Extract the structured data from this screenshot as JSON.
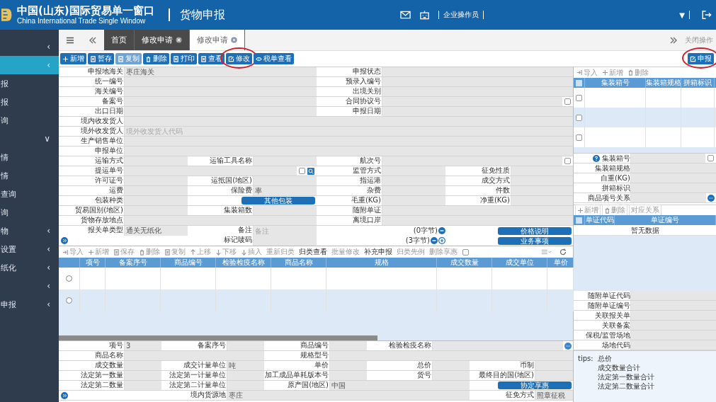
{
  "header": {
    "title": "中国(山东)国际贸易单一窗口",
    "subtitle": "China International Trade Single Window",
    "page": "货物申报",
    "user": "企业操作员",
    "dropdown": "▼"
  },
  "sidebar": {
    "items": [
      {
        "chevron": "‹",
        "selected": false
      },
      {
        "chevron": "‹",
        "selected": true
      },
      {
        "label": "报",
        "selected": false
      },
      {
        "label": "报",
        "selected": false
      },
      {
        "label": "询",
        "selected": false
      },
      {
        "chevron": "∨",
        "selected": false
      },
      {
        "label": "情",
        "selected": false
      },
      {
        "label": "情",
        "selected": false
      },
      {
        "label": "查询",
        "selected": false
      },
      {
        "label": "询",
        "selected": false
      },
      {
        "label": "物",
        "chevron": "‹",
        "selected": false
      },
      {
        "label": "设置",
        "chevron": "‹",
        "selected": false
      },
      {
        "label": "纸化",
        "chevron": "‹",
        "selected": false
      },
      {
        "chevron": "‹",
        "selected": false
      },
      {
        "label": "申报",
        "chevron": "‹",
        "selected": false
      }
    ]
  },
  "tabs": {
    "items": [
      {
        "label": "首页",
        "closable": false,
        "selected": false
      },
      {
        "label": "修改申请",
        "closable": true,
        "selected": false
      },
      {
        "label": "修改申请",
        "closable": true,
        "selected": true
      }
    ],
    "close_menu": "关闭操作"
  },
  "toolbar": {
    "buttons": [
      {
        "label": "新增",
        "disabled": false,
        "highlighted": false
      },
      {
        "label": "暂存",
        "disabled": false,
        "highlighted": false
      },
      {
        "label": "复制",
        "disabled": true,
        "highlighted": false
      },
      {
        "label": "删除",
        "disabled": false,
        "highlighted": false
      },
      {
        "label": "打印",
        "disabled": false,
        "highlighted": false
      },
      {
        "label": "查看",
        "disabled": false,
        "highlighted": false
      },
      {
        "label": "修改",
        "disabled": false,
        "highlighted": true
      },
      {
        "label": "税单查看",
        "disabled": false,
        "highlighted": false
      }
    ],
    "submit": {
      "label": "申报",
      "highlighted": true
    }
  },
  "form": {
    "rows": [
      [
        {
          "kind": "field",
          "label": "申报地海关",
          "value": "枣庄海关"
        },
        "",
        {
          "kind": "field",
          "label": "申报状态"
        },
        ""
      ],
      [
        {
          "kind": "field",
          "label": "统一编号"
        },
        "",
        {
          "kind": "field",
          "label": "预录入编号"
        },
        ""
      ],
      [
        {
          "kind": "field",
          "label": "海关编号"
        },
        "",
        {
          "kind": "field",
          "label": "出境关别"
        },
        ""
      ],
      [
        {
          "kind": "field",
          "label": "备案号"
        },
        "",
        {
          "kind": "field",
          "label": "合同协议号",
          "checked": false
        },
        ""
      ],
      [
        {
          "kind": "field",
          "label": "出口日期"
        },
        "",
        {
          "kind": "field",
          "label": "申报日期"
        },
        ""
      ],
      [
        {
          "kind": "field",
          "label": "境内收发货人"
        },
        "",
        "",
        ""
      ],
      [
        {
          "kind": "field",
          "label": "境外收发货人",
          "placeholder": "境外收发货人代码"
        },
        "",
        "",
        ""
      ],
      [
        {
          "kind": "field",
          "label": "生产销售单位"
        },
        "",
        "",
        ""
      ],
      [
        {
          "kind": "field",
          "label": "申报单位"
        },
        "",
        "",
        ""
      ],
      [
        {
          "kind": "field",
          "label": "运输方式"
        },
        {
          "kind": "field",
          "label": "运输工具名称"
        },
        {
          "kind": "field",
          "label": "航次号",
          "checked": false
        },
        ""
      ],
      [
        {
          "kind": "field",
          "label": "提运单号",
          "checked": false,
          "lookup": true
        },
        "",
        {
          "kind": "field",
          "label": "监管方式"
        },
        {
          "kind": "field",
          "label": "征免性质"
        }
      ],
      [
        {
          "kind": "field",
          "label": "许可证号"
        },
        {
          "kind": "field",
          "label": "运抵国(地区)"
        },
        {
          "kind": "field",
          "label": "指运港"
        },
        {
          "kind": "field",
          "label": "成交方式"
        }
      ],
      [
        {
          "kind": "field",
          "label": "运费"
        },
        {
          "kind": "field",
          "label": "保险费",
          "value": "率"
        },
        {
          "kind": "field",
          "label": "杂费"
        },
        {
          "kind": "field",
          "label": "件数"
        }
      ],
      [
        {
          "kind": "field",
          "label": "包装种类"
        },
        {
          "kind": "button",
          "label": "其他包装"
        },
        {
          "kind": "field",
          "label": "毛重(KG)"
        },
        {
          "kind": "field",
          "label": "净重(KG)"
        }
      ],
      [
        {
          "kind": "field",
          "label": "贸易国别(地区)"
        },
        {
          "kind": "field",
          "label": "集装箱数"
        },
        {
          "kind": "field",
          "label": "随附单证"
        },
        ""
      ],
      [
        {
          "kind": "field",
          "label": "货物存放地点"
        },
        "",
        {
          "kind": "field",
          "label": "离境口岸"
        },
        ""
      ],
      [
        {
          "kind": "field",
          "label": "报关单类型",
          "value": "通关无纸化"
        },
        {
          "kind": "field",
          "label": "备注",
          "placeholder": "备注"
        },
        {
          "kind": "counter",
          "text": "(0字节)",
          "plus": false
        },
        {
          "kind": "button",
          "label": "价格说明"
        }
      ],
      [
        {
          "kind": "expand"
        },
        {
          "kind": "field",
          "label": "标记唛码"
        },
        {
          "kind": "counter",
          "text": "(3字节)",
          "plus": true
        },
        {
          "kind": "button",
          "label": "业务事项"
        }
      ]
    ]
  },
  "goods": {
    "toolbar": [
      {
        "label": "导入",
        "disabled": true
      },
      {
        "label": "新增",
        "disabled": true
      },
      {
        "label": "保存",
        "disabled": true
      },
      {
        "label": "删除",
        "disabled": true
      },
      {
        "label": "复制",
        "disabled": true
      },
      {
        "label": "上移",
        "disabled": true
      },
      {
        "label": "下移",
        "disabled": true
      },
      {
        "label": "插入",
        "disabled": true
      },
      {
        "label": "重新归类",
        "disabled": true
      },
      {
        "label": "归类查看",
        "disabled": false
      },
      {
        "label": "批量修改",
        "disabled": true
      },
      {
        "label": "补充申报",
        "disabled": false
      },
      {
        "label": "归类先例",
        "disabled": true
      },
      {
        "label": "删除享惠",
        "disabled": true
      }
    ],
    "toolbar_checked": false,
    "columns": [
      "项号",
      "备案序号",
      "商品编号",
      "检验检疫名称",
      "商品名称",
      "规格",
      "成交数量",
      "成交单位",
      "单价"
    ],
    "rows": [
      {
        "selected": false
      },
      {
        "selected": false
      }
    ]
  },
  "item_form": {
    "rows": [
      [
        {
          "kind": "field",
          "label": "项号",
          "value": "3"
        },
        {
          "kind": "field",
          "label": "备案序号"
        },
        {
          "kind": "field",
          "label": "商品编号"
        },
        {
          "kind": "field",
          "label": "检验检疫名称",
          "more": true
        },
        ""
      ],
      [
        {
          "kind": "field",
          "label": "商品名称"
        },
        "",
        {
          "kind": "field",
          "label": "规格型号"
        },
        "",
        ""
      ],
      [
        {
          "kind": "field",
          "label": "成交数量"
        },
        {
          "kind": "field",
          "label": "成交计量单位",
          "value": "吨"
        },
        {
          "kind": "field",
          "label": "单价"
        },
        {
          "kind": "field",
          "label": "总价"
        },
        {
          "kind": "field",
          "label": "币制"
        }
      ],
      [
        {
          "kind": "field",
          "label": "法定第一数量"
        },
        {
          "kind": "field",
          "label": "法定第一计量单位"
        },
        {
          "kind": "field",
          "label": "加工成品单耗版本号"
        },
        {
          "kind": "field",
          "label": "货号"
        },
        {
          "kind": "field",
          "label": "最终目的国(地区)"
        }
      ],
      [
        {
          "kind": "field",
          "label": "法定第二数量"
        },
        {
          "kind": "field",
          "label": "法定第二计量单位"
        },
        {
          "kind": "field",
          "label": "原产国(地区)",
          "value": "中国"
        },
        "",
        {
          "kind": "button",
          "label": "协定享惠"
        }
      ],
      [
        {
          "kind": "expand"
        },
        {
          "kind": "field",
          "label": "境内货源地",
          "value": "枣庄"
        },
        "",
        "",
        {
          "kind": "field",
          "label": "征免方式",
          "value": "照章征税"
        }
      ]
    ]
  },
  "containers": {
    "toolbar": [
      {
        "label": "导入",
        "disabled": true
      },
      {
        "label": "新增",
        "disabled": true
      },
      {
        "label": "删除",
        "disabled": true
      }
    ],
    "header_checked": false,
    "columns": [
      "集装箱号",
      "集装箱规格",
      "拼箱标识"
    ],
    "rows": [
      {
        "checked": false
      },
      {
        "checked": false
      },
      {
        "checked": false
      }
    ],
    "fields": [
      {
        "label": "集装箱号",
        "help": true,
        "checked": false
      },
      {
        "label": "集装箱规格"
      },
      {
        "label": "自重(KG)"
      },
      {
        "label": "拼箱标识"
      },
      {
        "label": "商品项号关系",
        "more": true
      }
    ]
  },
  "documents": {
    "toolbar": [
      {
        "label": "新增",
        "disabled": true
      },
      {
        "label": "删除",
        "disabled": true
      },
      {
        "label": "对应关系",
        "disabled": true
      }
    ],
    "header_checked": false,
    "columns": [
      "单证代码",
      "单证编号"
    ],
    "empty": "暂无数据",
    "fields": [
      {
        "label": "随附单证代码"
      },
      {
        "label": "随附单证编号"
      },
      {
        "label": "关联报关单"
      },
      {
        "label": "关联备案"
      },
      {
        "label": "保税/监管场地"
      },
      {
        "label": "场地代码"
      }
    ]
  },
  "tips": {
    "label": "tips:",
    "lines": [
      "总价",
      "成交数量合计",
      "法定第一数量合计",
      "法定第二数量合计"
    ]
  }
}
